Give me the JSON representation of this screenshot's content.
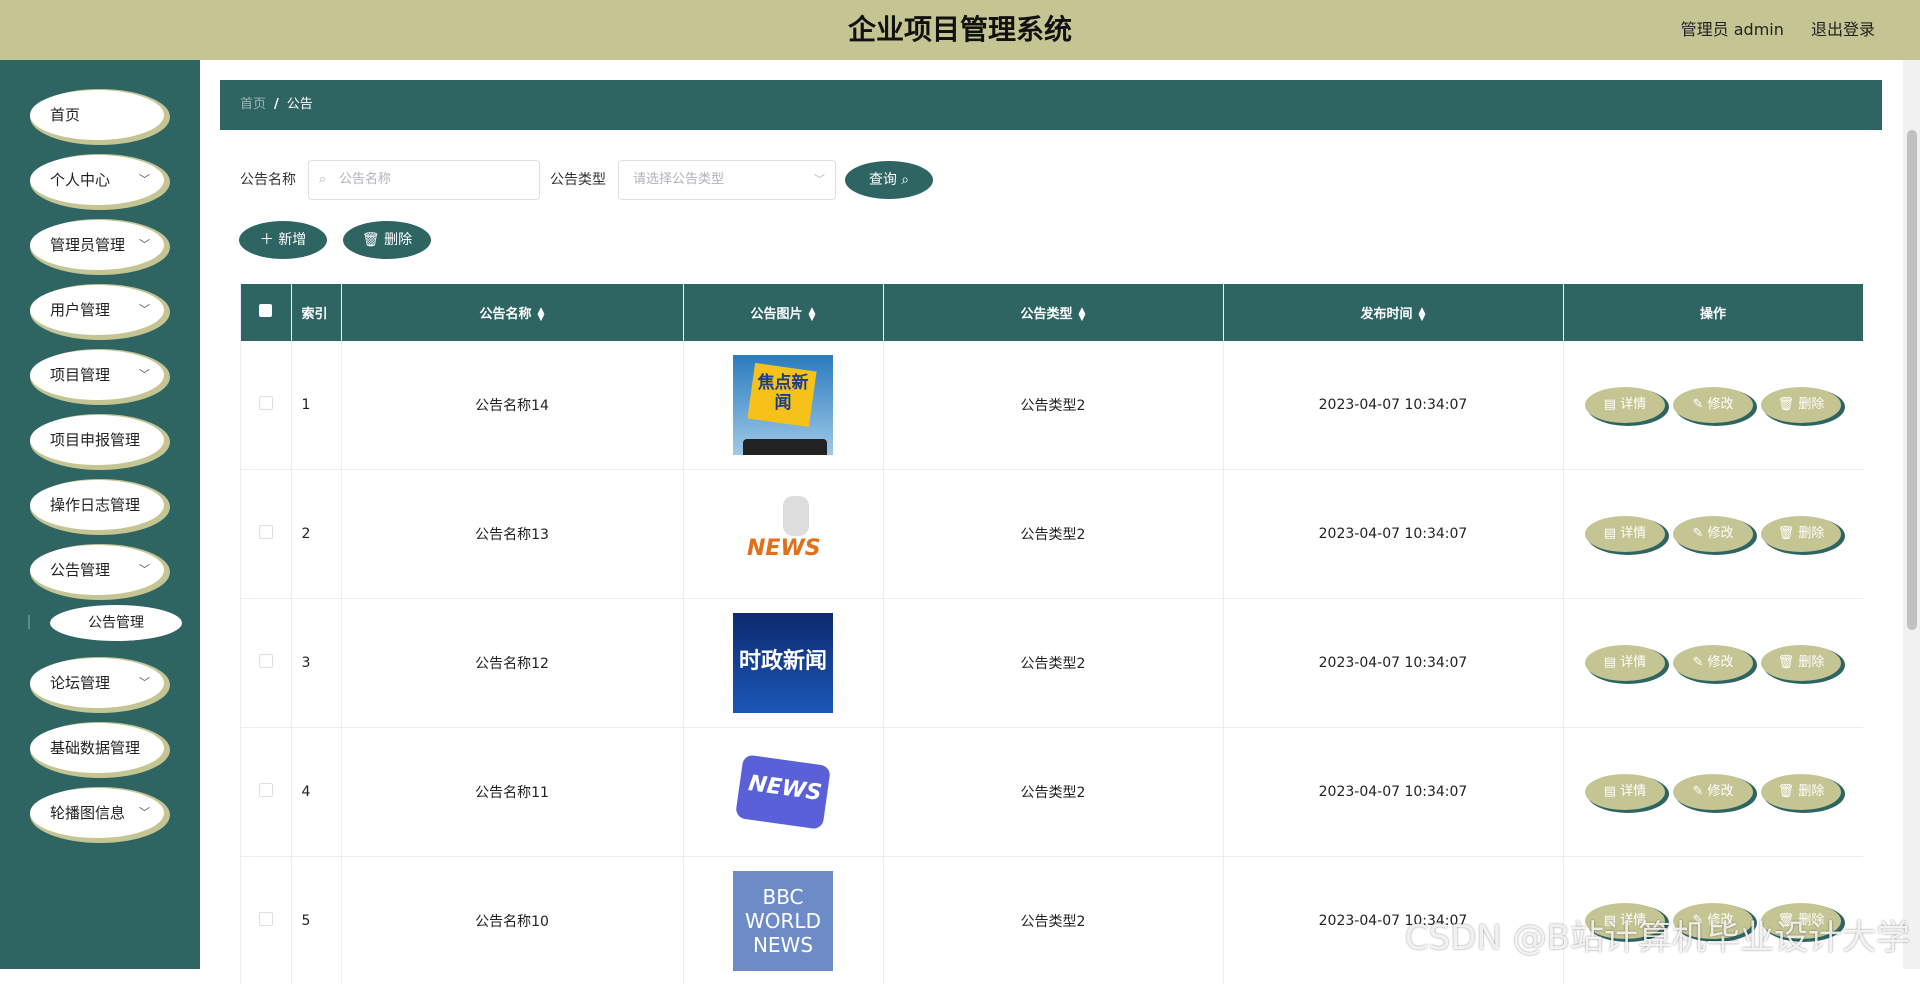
{
  "header": {
    "title": "企业项目管理系统",
    "user_label": "管理员 admin",
    "logout_label": "退出登录"
  },
  "sidebar": {
    "items": [
      {
        "label": "首页",
        "has_arrow": false
      },
      {
        "label": "个人中心",
        "has_arrow": true
      },
      {
        "label": "管理员管理",
        "has_arrow": true
      },
      {
        "label": "用户管理",
        "has_arrow": true
      },
      {
        "label": "项目管理",
        "has_arrow": true
      },
      {
        "label": "项目申报管理",
        "has_arrow": false
      },
      {
        "label": "操作日志管理",
        "has_arrow": false
      },
      {
        "label": "公告管理",
        "has_arrow": true
      },
      {
        "label": "论坛管理",
        "has_arrow": true
      },
      {
        "label": "基础数据管理",
        "has_arrow": false
      },
      {
        "label": "轮播图信息",
        "has_arrow": true
      }
    ],
    "sub_item": "公告管理"
  },
  "breadcrumb": {
    "home": "首页",
    "separator": "/",
    "current": "公告"
  },
  "search": {
    "name_label": "公告名称",
    "name_placeholder": "公告名称",
    "type_label": "公告类型",
    "type_placeholder": "请选择公告类型",
    "query_button": "查询"
  },
  "actions": {
    "add": "新增",
    "delete": "删除"
  },
  "table": {
    "columns": [
      "索引",
      "公告名称",
      "公告图片",
      "公告类型",
      "发布时间",
      "操作"
    ],
    "rows": [
      {
        "index": "1",
        "name": "公告名称14",
        "image": "焦点新闻",
        "type": "公告类型2",
        "time": "2023-04-07 10:34:07"
      },
      {
        "index": "2",
        "name": "公告名称13",
        "image": "NEWS",
        "type": "公告类型2",
        "time": "2023-04-07 10:34:07"
      },
      {
        "index": "3",
        "name": "公告名称12",
        "image": "时政新闻",
        "type": "公告类型2",
        "time": "2023-04-07 10:34:07"
      },
      {
        "index": "4",
        "name": "公告名称11",
        "image": "NEWS",
        "type": "公告类型2",
        "time": "2023-04-07 10:34:07"
      },
      {
        "index": "5",
        "name": "公告名称10",
        "image": "BBC WORLD NEWS",
        "type": "公告类型2",
        "time": "2023-04-07 10:34:07"
      }
    ],
    "ops": [
      "详情",
      "修改",
      "删除"
    ]
  },
  "watermark": "CSDN @B站计算机毕业设计大学",
  "colors": {
    "accent": "#2e6462",
    "olive": "#c5c594"
  }
}
